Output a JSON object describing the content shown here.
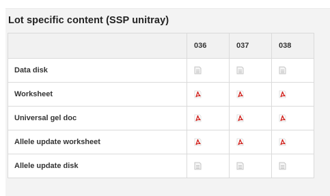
{
  "panel": {
    "title": "Lot specific content (SSP unitray)"
  },
  "table": {
    "columns": [
      "036",
      "037",
      "038"
    ],
    "rows": [
      {
        "label": "Data disk",
        "icon": "disk-icon"
      },
      {
        "label": "Worksheet",
        "icon": "pdf-icon"
      },
      {
        "label": "Universal gel doc",
        "icon": "pdf-icon"
      },
      {
        "label": "Allele update worksheet",
        "icon": "pdf-icon"
      },
      {
        "label": "Allele update disk",
        "icon": "disk-icon"
      }
    ]
  },
  "colors": {
    "panel_bg": "#f3f3f3",
    "header_bg": "#f1f1f1",
    "border": "#dadada",
    "pdf_red": "#d0201b",
    "disk_gray": "#c4c4c4"
  }
}
